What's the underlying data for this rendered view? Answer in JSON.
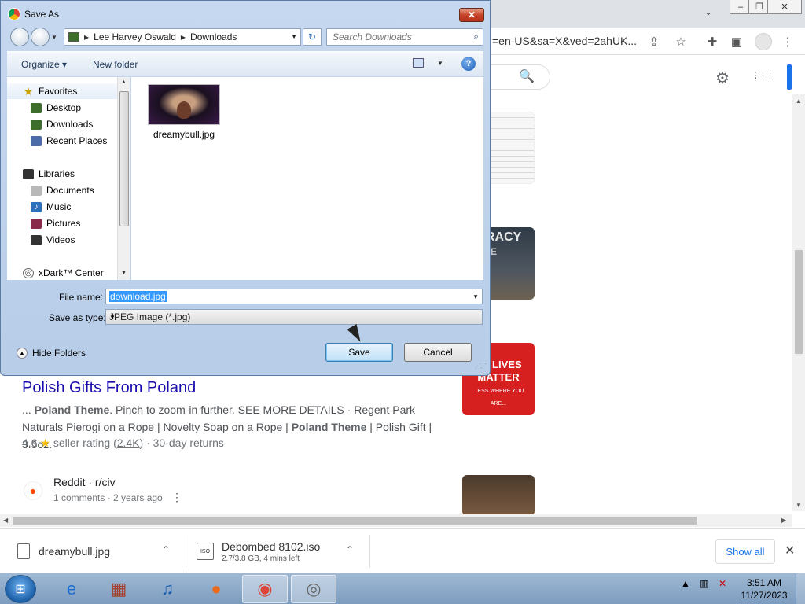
{
  "chrome": {
    "omnibox_tail": "=en-US&sa=X&ved=2ahUK...",
    "win_minimize": "–",
    "win_restore": "❐",
    "win_close": "✕",
    "tab_dropdown": "⌄",
    "icons": {
      "share": "⇪",
      "bookmark_star": "☆",
      "extensions": "✚",
      "sidebar": "▣",
      "menu": "⋮",
      "search": "🔍",
      "settings": "⚙",
      "apps": "⋮⋮⋮"
    }
  },
  "search_result": {
    "title": "Polish Gifts From Poland",
    "snippet_prefix": "... ",
    "snippet_b1": "Poland Theme",
    "snippet_mid": ". Pinch to zoom-in further. SEE MORE DETAILS · Regent Park Naturals Pierogi on a Rope | Novelty Soap on a Rope | ",
    "snippet_b2": "Poland Theme",
    "snippet_end": " | Polish Gift | 3.5oz.",
    "rating": "4.6",
    "rating_star": "★",
    "rating_text": "seller rating (",
    "rating_count": "2.4K",
    "rating_tail": ") · 30-day returns"
  },
  "thumbnails": {
    "democracy_text": "OCRACY",
    "democracy_sub": "I ? O E",
    "polish_title": "SH LIVES MATTER",
    "polish_sub": "...ESS WHERE YOU ARE..."
  },
  "reddit_result": {
    "source": "Reddit · r/civ",
    "meta": "1 comments · 2 years ago",
    "kebab": "⋮"
  },
  "downloads": {
    "item1_name": "dreamybull.jpg",
    "item2_name": "Debombed 8102.iso",
    "item2_sub": "2.7/3.8 GB, 4 mins left",
    "item2_icon": "ISO",
    "chevron": "⌃",
    "show_all": "Show all",
    "close": "✕"
  },
  "taskbar": {
    "time": "3:51 AM",
    "date": "11/27/2023",
    "tray_arrow": "▲"
  },
  "dialog": {
    "title": "Save As",
    "close": "✕",
    "breadcrumb": [
      "Lee Harvey Oswald",
      "Downloads"
    ],
    "breadcrumb_sep": "▶",
    "refresh": "↻",
    "search_placeholder": "Search Downloads",
    "organize": "Organize ▾",
    "new_folder": "New folder",
    "help": "?",
    "nav": {
      "favorites": "Favorites",
      "desktop": "Desktop",
      "downloads": "Downloads",
      "recent": "Recent Places",
      "libraries": "Libraries",
      "documents": "Documents",
      "music": "Music",
      "pictures": "Pictures",
      "videos": "Videos",
      "xdark": "xDark™ Center"
    },
    "file": {
      "name": "dreamybull.jpg"
    },
    "file_name_label": "File name:",
    "file_name_value": "download.jpg",
    "save_type_label": "Save as type:",
    "save_type_value": "JPEG Image (*.jpg)",
    "hide_folders": "Hide Folders",
    "save": "Save",
    "cancel": "Cancel"
  }
}
